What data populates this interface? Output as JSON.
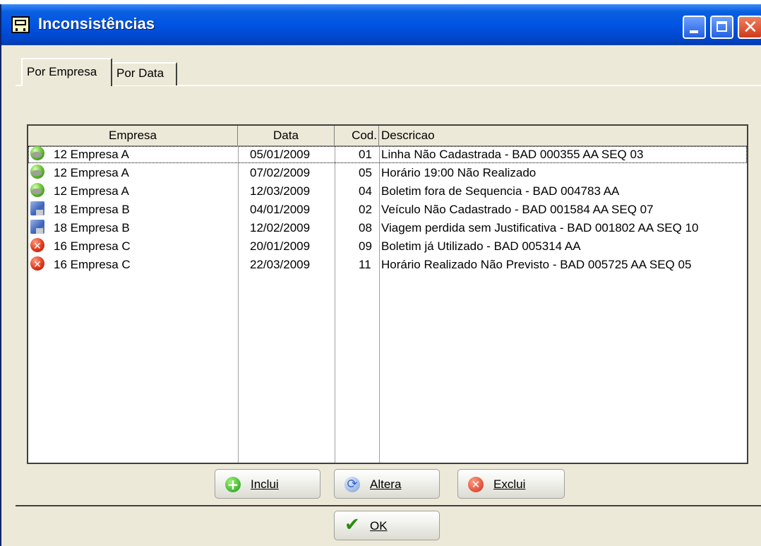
{
  "window": {
    "title": "Inconsistências"
  },
  "tabs": [
    {
      "label": "Por Empresa"
    },
    {
      "label": "Por Data"
    }
  ],
  "grid": {
    "columns": [
      "Empresa",
      "Data",
      "Cod.",
      "Descricao"
    ],
    "rows": [
      {
        "icon": "green-check-icon",
        "empresa": "12  Empresa A",
        "data": "05/01/2009",
        "cod": "01",
        "descricao": "Linha Não Cadastrada - BAD 000355 AA SEQ 03"
      },
      {
        "icon": "green-check-icon",
        "empresa": "12  Empresa A",
        "data": "07/02/2009",
        "cod": "05",
        "descricao": "Horário 19:00 Não Realizado"
      },
      {
        "icon": "green-check-icon",
        "empresa": "12  Empresa A",
        "data": "12/03/2009",
        "cod": "04",
        "descricao": "Boletim fora de Sequencia - BAD 004783 AA"
      },
      {
        "icon": "monitor-icon",
        "empresa": "18  Empresa B",
        "data": "04/01/2009",
        "cod": "02",
        "descricao": "Veículo Não Cadastrado - BAD 001584 AA SEQ 07"
      },
      {
        "icon": "monitor-icon",
        "empresa": "18  Empresa B",
        "data": "12/02/2009",
        "cod": "08",
        "descricao": "Viagem perdida sem Justificativa - BAD 001802 AA SEQ 10"
      },
      {
        "icon": "red-error-icon",
        "empresa": "16  Empresa C",
        "data": "20/01/2009",
        "cod": "09",
        "descricao": "Boletim já Utilizado - BAD 005314 AA"
      },
      {
        "icon": "red-error-icon",
        "empresa": "16  Empresa C",
        "data": "22/03/2009",
        "cod": "11",
        "descricao": "Horário Realizado Não Previsto - BAD 005725 AA SEQ 05"
      }
    ]
  },
  "buttons": {
    "inclui": "Inclui",
    "altera": "Altera",
    "exclui": "Exclui",
    "ok": "OK"
  },
  "colors": {
    "titlebar": "#0054e3",
    "face": "#ece9d8"
  }
}
